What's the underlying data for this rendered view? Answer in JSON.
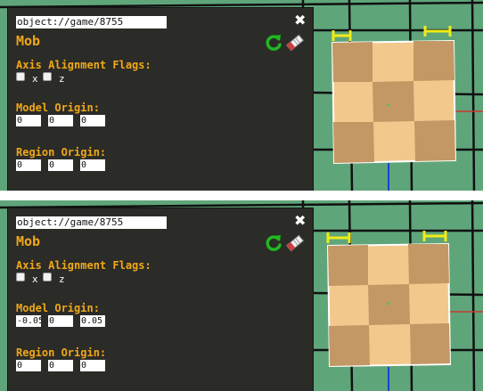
{
  "colors": {
    "ground": "#5fa57a",
    "grid_line": "#101010",
    "panel_bg": "#2b2b27",
    "accent": "#f0a818",
    "handle": "#f2ec16",
    "axis_blue": "#1a3fd8",
    "axis_red": "#c83a30",
    "tile_light": "#f2c88c",
    "tile_dark": "#c49864"
  },
  "frames": [
    {
      "url": "object://game/8755",
      "close_icon": "close-x-icon",
      "title": "Mob",
      "refresh_icon": "refresh-green-icon",
      "eraser_icon": "eraser-icon",
      "axis_flags_label": "Axis Alignment Flags:",
      "flag_x_label": "x",
      "flag_z_label": "z",
      "flag_x_checked": false,
      "flag_z_checked": false,
      "model_origin_label": "Model Origin:",
      "model_origin": [
        "0",
        "0",
        "0"
      ],
      "region_origin_label": "Region Origin:",
      "region_origin": [
        "0",
        "0",
        "0"
      ]
    },
    {
      "url": "object://game/8755",
      "close_icon": "close-x-icon",
      "title": "Mob",
      "refresh_icon": "refresh-green-icon",
      "eraser_icon": "eraser-icon",
      "axis_flags_label": "Axis Alignment Flags:",
      "flag_x_label": "x",
      "flag_z_label": "z",
      "flag_x_checked": false,
      "flag_z_checked": false,
      "model_origin_label": "Model Origin:",
      "model_origin": [
        "-0.05",
        "0",
        "0.05"
      ],
      "region_origin_label": "Region Origin:",
      "region_origin": [
        "0",
        "0",
        "0"
      ]
    }
  ]
}
